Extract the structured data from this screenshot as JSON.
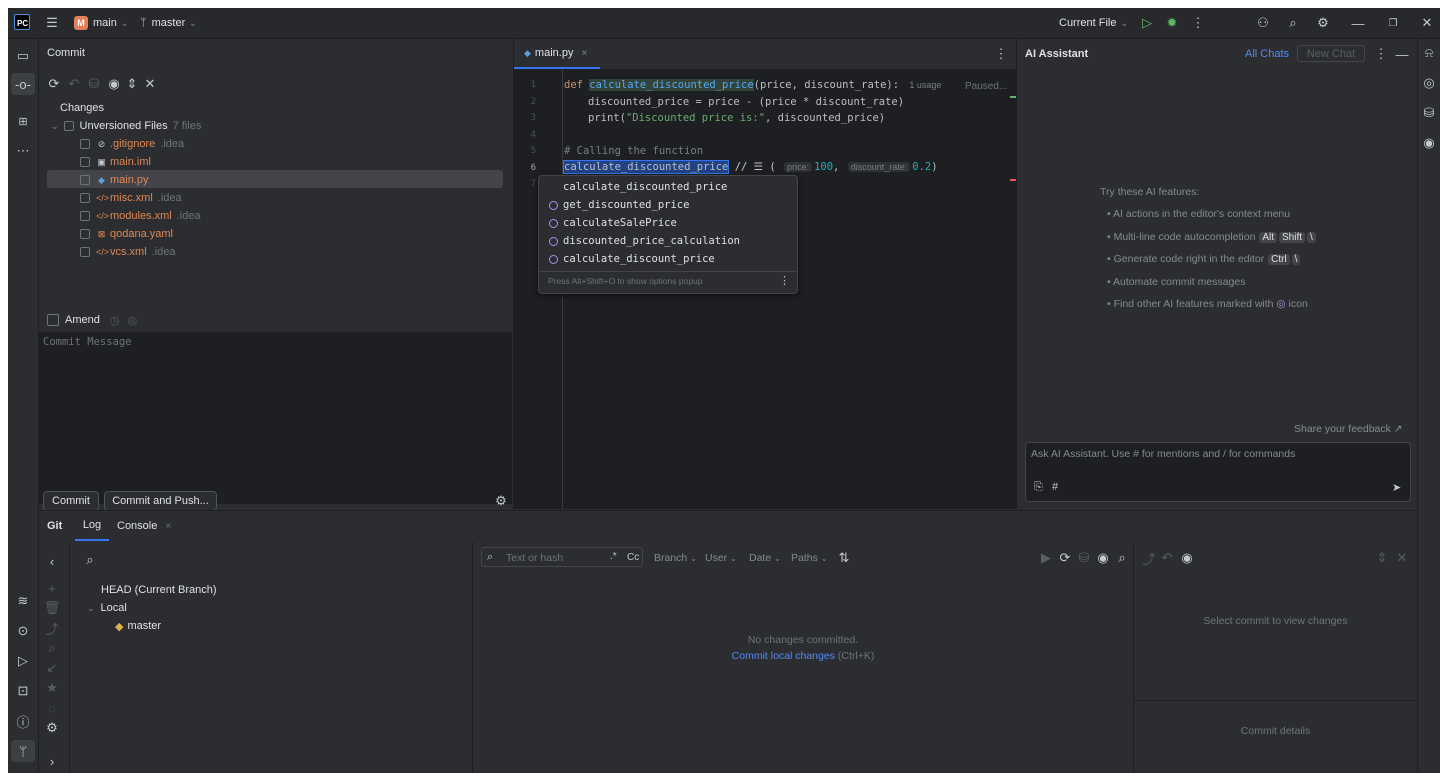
{
  "titlebar": {
    "project_badge": "M",
    "project": "main",
    "branch": "master",
    "run_config": "Current File"
  },
  "commit_panel": {
    "title": "Commit",
    "changes_label": "Changes",
    "unversioned_label": "Unversioned Files",
    "unversioned_count": "7 files",
    "files": [
      {
        "name": ".gitignore",
        "dir": ".idea"
      },
      {
        "name": "main.iml",
        "dir": ""
      },
      {
        "name": "main.py",
        "dir": ""
      },
      {
        "name": "misc.xml",
        "dir": ".idea"
      },
      {
        "name": "modules.xml",
        "dir": ".idea"
      },
      {
        "name": "qodana.yaml",
        "dir": ""
      },
      {
        "name": "vcs.xml",
        "dir": ".idea"
      }
    ],
    "amend_label": "Amend",
    "message_placeholder": "Commit Message",
    "commit_button": "Commit",
    "commit_push_button": "Commit and Push..."
  },
  "editor": {
    "tab": "main.py",
    "line_numbers": [
      "1",
      "2",
      "3",
      "4",
      "5",
      "6",
      "7"
    ],
    "lines": {
      "l1_kw": "def",
      "l1_fn": "calculate_discounted_price",
      "l1_rest": "(price, discount_rate):",
      "l1_usage": "1 usage",
      "paused": "Paused...",
      "l2": "discounted_price = price - (price * discount_rate)",
      "l3_pre": "print(",
      "l3_str": "\"Discounted price is:\"",
      "l3_post": ", discounted_price)",
      "l5": "# Calling the function",
      "l6_fn": "calculate_discounted_price",
      "l6_mid": "// ☰ (",
      "l6_hint1": "price:",
      "l6_val1": "100",
      "l6_comma": ",",
      "l6_hint2": "discount_rate:",
      "l6_val2": "0.2",
      "l6_end": ")"
    },
    "completions": [
      "calculate_discounted_price",
      "get_discounted_price",
      "calculateSalePrice",
      "discounted_price_calculation",
      "calculate_discount_price"
    ],
    "popup_hint": "Press Alt+Shift+O to show options popup"
  },
  "ai": {
    "title": "AI Assistant",
    "all_chats": "All Chats",
    "new_chat": "New Chat",
    "try_label": "Try these AI features:",
    "f1": "• AI actions in the editor's context menu",
    "f2": "• Multi-line code autocompletion",
    "f2_keys": [
      "Alt",
      "Shift",
      "\\"
    ],
    "f3": "• Generate code right in the editor",
    "f3_keys": [
      "Ctrl",
      "\\"
    ],
    "f4": "• Automate commit messages",
    "f5_pre": "• Find other AI features marked with",
    "f5_post": "icon",
    "feedback": "Share your feedback ↗",
    "input_placeholder": "Ask AI Assistant. Use # for mentions and / for commands"
  },
  "bottom": {
    "tabs": [
      "Git",
      "Log",
      "Console"
    ],
    "head": "HEAD (Current Branch)",
    "local": "Local",
    "master": "master",
    "search_placeholder": "Text or hash",
    "regex": ".*",
    "case": "Cc",
    "filters": [
      "Branch",
      "User",
      "Date",
      "Paths"
    ],
    "no_changes": "No changes committed.",
    "commit_local": "Commit local changes",
    "shortcut": "(Ctrl+K)",
    "select_commit": "Select commit to view changes",
    "commit_details": "Commit details"
  },
  "colors": {
    "accent": "#3574f0",
    "link": "#548af7",
    "unversioned": "#e08855"
  }
}
